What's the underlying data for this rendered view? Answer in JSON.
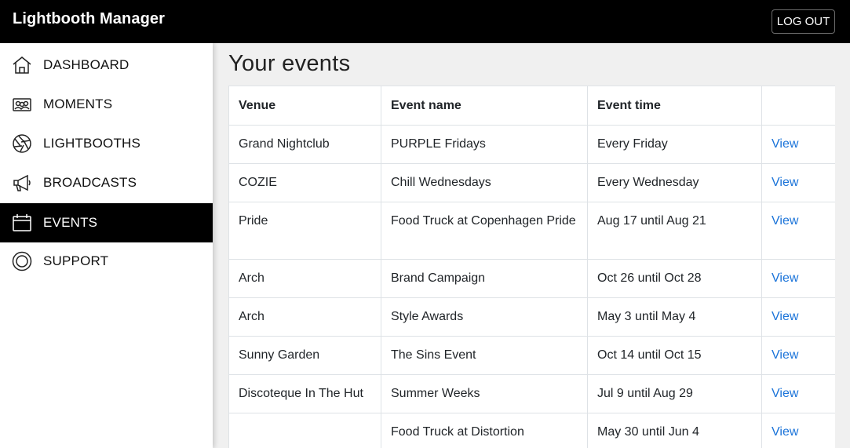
{
  "app": {
    "title": "Lightbooth Manager",
    "logout_label": "LOG OUT"
  },
  "sidebar": {
    "items": [
      {
        "label": "DASHBOARD",
        "icon": "home-icon"
      },
      {
        "label": "MOMENTS",
        "icon": "photos-icon"
      },
      {
        "label": "LIGHTBOOTHS",
        "icon": "aperture-icon"
      },
      {
        "label": "BROADCASTS",
        "icon": "megaphone-icon"
      },
      {
        "label": "EVENTS",
        "icon": "calendar-icon",
        "active": true
      },
      {
        "label": "SUPPORT",
        "icon": "lifebuoy-icon"
      }
    ]
  },
  "main": {
    "title": "Your events",
    "columns": [
      "Venue",
      "Event name",
      "Event time",
      ""
    ],
    "rows": [
      {
        "venue": "Grand Nightclub",
        "name": "PURPLE Fridays",
        "time": "Every Friday",
        "action": "View"
      },
      {
        "venue": "COZIE",
        "name": "Chill Wednesdays",
        "time": "Every Wednesday",
        "action": "View"
      },
      {
        "venue": "Pride",
        "name": "Food Truck at Copenhagen Pride",
        "time": "Aug 17 until Aug 21",
        "action": "View"
      },
      {
        "venue": "Arch",
        "name": "Brand Campaign",
        "time": "Oct 26 until Oct 28",
        "action": "View"
      },
      {
        "venue": "Arch",
        "name": "Style Awards",
        "time": "May 3 until May 4",
        "action": "View"
      },
      {
        "venue": "Sunny Garden",
        "name": "The Sins Event",
        "time": "Oct 14 until Oct 15",
        "action": "View"
      },
      {
        "venue": "Discoteque In The Hut",
        "name": "Summer Weeks",
        "time": "Jul 9 until Aug 29",
        "action": "View"
      },
      {
        "venue": "",
        "name": "Food Truck at Distortion",
        "time": "May 30 until Jun 4",
        "action": "View"
      }
    ]
  },
  "colors": {
    "topbar": "#000000",
    "active_nav": "#000000",
    "link": "#1a73d9",
    "background": "#f0f0f0"
  }
}
